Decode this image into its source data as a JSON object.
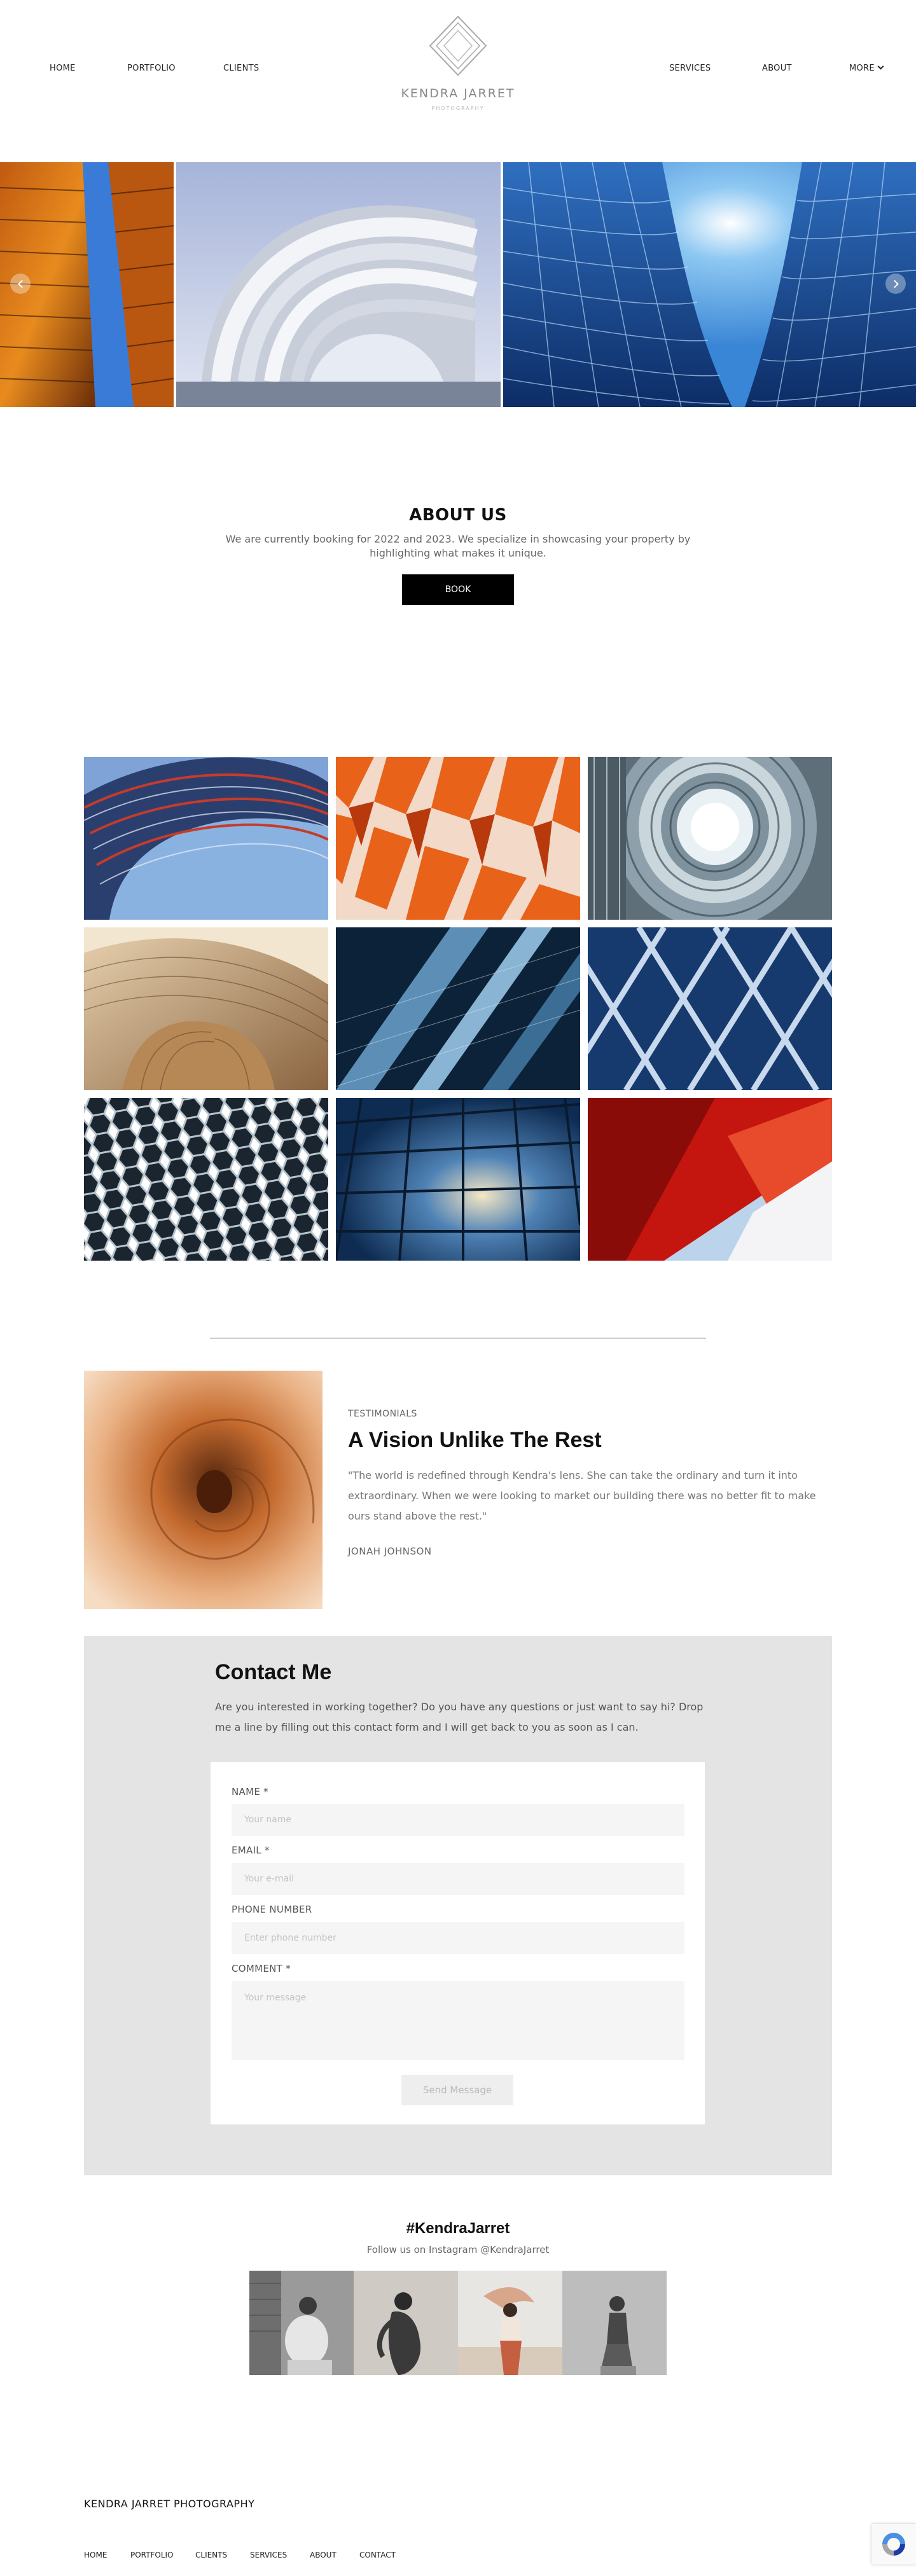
{
  "header": {
    "nav_left": [
      "HOME",
      "PORTFOLIO",
      "CLIENTS"
    ],
    "nav_right": [
      "SERVICES",
      "ABOUT",
      "MORE"
    ],
    "logo_name": "KENDRA JARRET",
    "logo_tagline": "PHOTOGRAPHY"
  },
  "hero": {
    "slides": [
      "orange-glass-tower",
      "white-arch-sculpture",
      "blue-glass-skyscraper"
    ],
    "prev_icon": "chevron-left-icon",
    "next_icon": "chevron-right-icon"
  },
  "about": {
    "title": "ABOUT US",
    "text": "We are currently booking for 2022 and 2023. We specialize in showcasing your property by highlighting what makes it unique.",
    "button": "BOOK"
  },
  "gallery": {
    "images": [
      "curved-blue-facade",
      "orange-geometric-facade",
      "spiral-staircase",
      "wooden-curved-ceiling",
      "dark-glass-angles",
      "blue-diagonal-grid",
      "hexagon-pattern",
      "glass-roof",
      "red-building-angles"
    ]
  },
  "testimonial": {
    "eyebrow": "TESTIMONIALS",
    "title": "A Vision Unlike The Rest",
    "quote": "\"The world is redefined through Kendra's lens.  She can take the ordinary and turn it into extraordinary.  When we were looking to market our building there was no better fit to make ours stand above the rest.\"",
    "author": "JONAH JOHNSON"
  },
  "contact": {
    "title": "Contact Me",
    "intro": "Are you interested in working together? Do you have any questions or just want to say hi? Drop me a line by filling out this contact form and I will get back to you as soon as I can.",
    "fields": {
      "name_label": "NAME *",
      "name_placeholder": "Your name",
      "email_label": "EMAIL *",
      "email_placeholder": "Your e-mail",
      "phone_label": "PHONE NUMBER",
      "phone_placeholder": "Enter phone number",
      "comment_label": "COMMENT *",
      "comment_placeholder": "Your message"
    },
    "send_button": "Send Message"
  },
  "instagram": {
    "title": "#KendraJarret",
    "subtitle": "Follow us on Instagram @KendraJarret"
  },
  "footer": {
    "brand": "KENDRA JARRET PHOTOGRAPHY",
    "links": [
      "HOME",
      "PORTFOLIO",
      "CLIENTS",
      "SERVICES",
      "ABOUT",
      "CONTACT"
    ]
  },
  "colors": {
    "accent": "#000000",
    "contact_bg": "#e4e4e4",
    "input_bg": "#f5f5f5"
  }
}
